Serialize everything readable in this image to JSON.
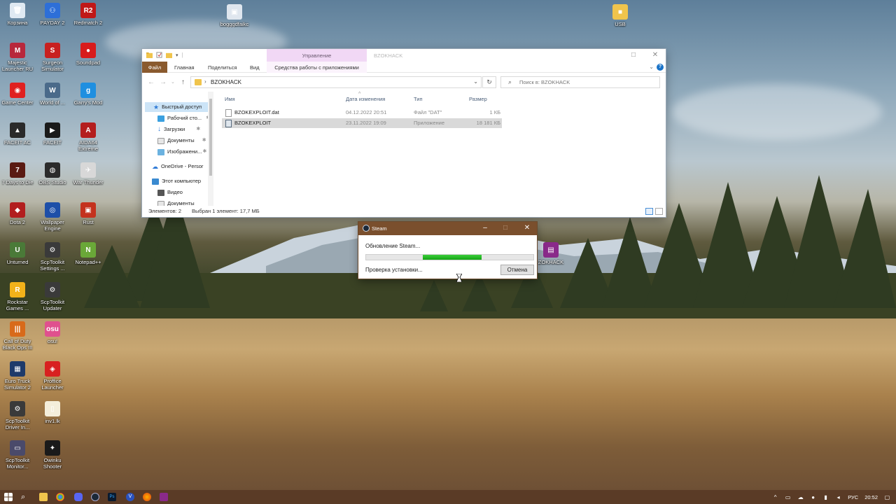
{
  "desktop": {
    "icons": [
      {
        "label": "Корзина",
        "color": "#dfe9f2",
        "glyph": "🗑"
      },
      {
        "label": "PAYDAY 2",
        "color": "#2d6fd8",
        "glyph": "⚇"
      },
      {
        "label": "Redmatch 2",
        "color": "#c01818",
        "glyph": "R2"
      },
      {
        "label": "Majestic Launcher RU",
        "color": "#b8283c",
        "glyph": "M"
      },
      {
        "label": "Surgeon Simulator",
        "color": "#c82020",
        "glyph": "S"
      },
      {
        "label": "Soundpad",
        "color": "#d81c1c",
        "glyph": "●"
      },
      {
        "label": "Game Center",
        "color": "#e02020",
        "glyph": "◉"
      },
      {
        "label": "World of ...",
        "color": "#4a6a8a",
        "glyph": "W"
      },
      {
        "label": "Garry's Mod",
        "color": "#1f8fe0",
        "glyph": "g"
      },
      {
        "label": "FACEIT AC",
        "color": "#2a2a2a",
        "glyph": "▲"
      },
      {
        "label": "FACEIT",
        "color": "#1a1a1a",
        "glyph": "▶"
      },
      {
        "label": "AIDA64 Extreme",
        "color": "#b41e1e",
        "glyph": "A"
      },
      {
        "label": "7 Days to Die",
        "color": "#5a1a12",
        "glyph": "7"
      },
      {
        "label": "OBS Studio",
        "color": "#2b2b2b",
        "glyph": "◍"
      },
      {
        "label": "War Thunder",
        "color": "#d8d8d8",
        "glyph": "✈"
      },
      {
        "label": "Dota 2",
        "color": "#b21e1e",
        "glyph": "◆"
      },
      {
        "label": "Wallpaper Engine",
        "color": "#1e4fa8",
        "glyph": "◎"
      },
      {
        "label": "Rust",
        "color": "#c4321e",
        "glyph": "▣"
      },
      {
        "label": "Unturned",
        "color": "#4a7a38",
        "glyph": "U"
      },
      {
        "label": "ScpToolkit Settings ...",
        "color": "#3a3a3a",
        "glyph": "⚙"
      },
      {
        "label": "Notepad++",
        "color": "#6aa838",
        "glyph": "N"
      },
      {
        "label": "Rockstar Games ...",
        "color": "#f2b21a",
        "glyph": "R"
      },
      {
        "label": "ScpToolkit Updater",
        "color": "#3a3a3a",
        "glyph": "⚙"
      },
      {
        "label": "Call of Duty Black Ops III",
        "color": "#d86a1a",
        "glyph": "|||"
      },
      {
        "label": "osu!",
        "color": "#e0508e",
        "glyph": "osu"
      },
      {
        "label": "Euro Truck Simulator 2",
        "color": "#1e3a6a",
        "glyph": "▦"
      },
      {
        "label": "Proffice Launcher",
        "color": "#d82020",
        "glyph": "◈"
      },
      {
        "label": "ScpToolkit Driver In...",
        "color": "#3a3a3a",
        "glyph": "⚙"
      },
      {
        "label": "inv1.lk",
        "color": "#f4eeda",
        "glyph": "▯"
      },
      {
        "label": "ScpToolkit Monitor...",
        "color": "#4a4a6a",
        "glyph": "▭"
      },
      {
        "label": "Owinku Shooter",
        "color": "#1a1a1a",
        "glyph": "✦"
      },
      {
        "label": "bogggdfaikc",
        "color": "#dfe6ee",
        "glyph": "▣"
      },
      {
        "label": "USB",
        "color": "#f0c44c",
        "glyph": "■"
      },
      {
        "label": "ZOKHACK",
        "color": "#8a2a8a",
        "glyph": "▤"
      }
    ]
  },
  "explorer": {
    "title": "BZOKHACK",
    "manage_tab": "Управление",
    "ribbon": {
      "file": "Файл",
      "home": "Главная",
      "share": "Поделиться",
      "view": "Вид",
      "app_tools": "Средства работы с приложениями"
    },
    "address": "BZOKHACK",
    "search_placeholder": "Поиск в: BZOKHACK",
    "nav": {
      "quick_access": "Быстрый доступ",
      "desktop": "Рабочий сто...",
      "downloads": "Загрузки",
      "documents": "Документы",
      "pictures": "Изображени...",
      "onedrive": "OneDrive - Persor",
      "this_pc": "Этот компьютер",
      "video": "Видео",
      "pc_docs": "Документы"
    },
    "columns": {
      "name": "Имя",
      "date": "Дата изменения",
      "type": "Тип",
      "size": "Размер"
    },
    "files": [
      {
        "name": "BZOKEXPLOIT.dat",
        "date": "04.12.2022 20:51",
        "type": "Файл \"DAT\"",
        "size": "1 КБ"
      },
      {
        "name": "BZOKEXPLOIT",
        "date": "23.11.2022 19:09",
        "type": "Приложение",
        "size": "18 181 КБ"
      }
    ],
    "status": {
      "count": "Элементов: 2",
      "selected": "Выбран 1 элемент: 17,7 МБ"
    }
  },
  "steam": {
    "title": "Steam",
    "status": "Обновление Steam...",
    "progress_start": 0.34,
    "progress_end": 0.69,
    "substatus": "Проверка установки...",
    "cancel": "Отмена"
  },
  "taskbar": {
    "lang": "РУС",
    "time": "20:52"
  },
  "colors": {
    "steam_title": "#7a4f2d",
    "taskbar": "#5a3b26",
    "progress": "#1faf1f",
    "manage_tab": "#f1d8f5"
  }
}
